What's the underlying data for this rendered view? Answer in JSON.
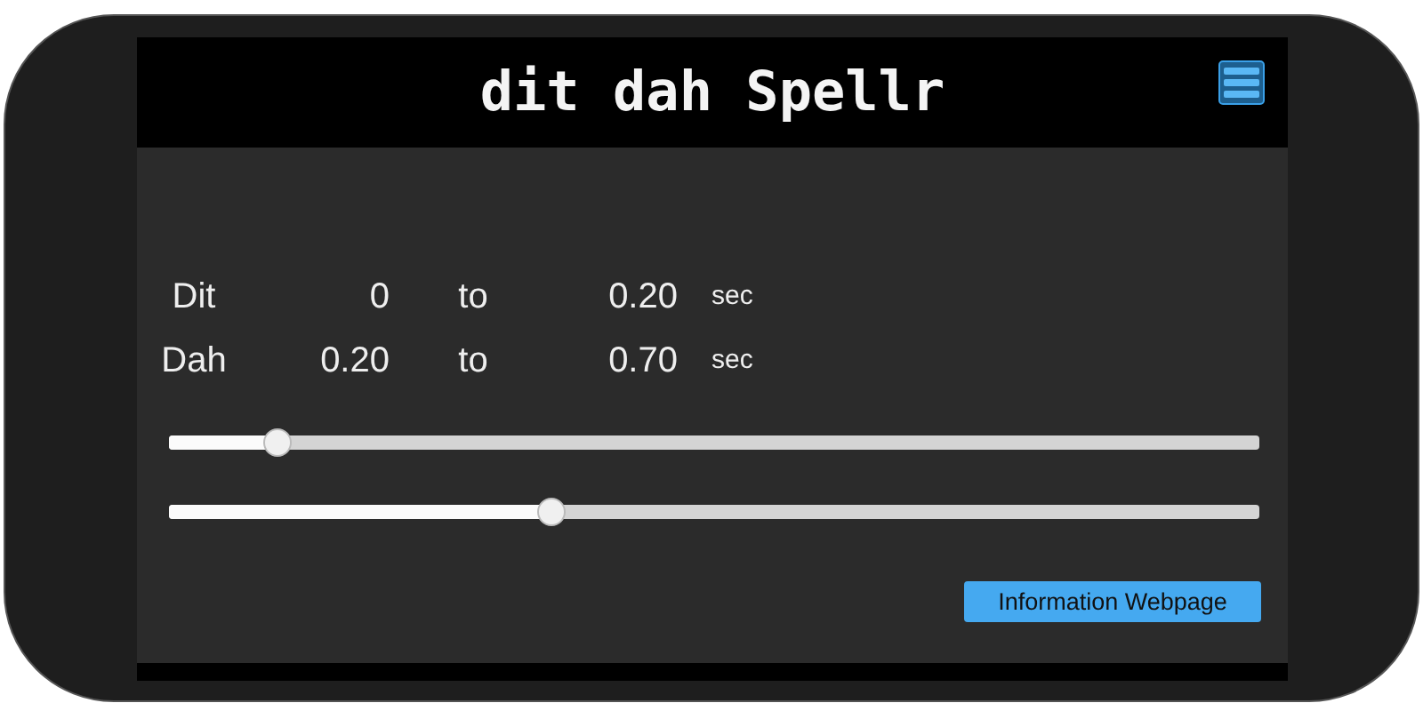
{
  "header": {
    "title": "dit dah Spellr"
  },
  "ranges": [
    {
      "label": "Dit",
      "from": "0",
      "joiner": "to",
      "to": "0.20",
      "unit": "sec"
    },
    {
      "label": "Dah",
      "from": "0.20",
      "joiner": "to",
      "to": "0.70",
      "unit": "sec"
    }
  ],
  "sliders": [
    {
      "level": 0.1
    },
    {
      "level": 0.35
    }
  ],
  "button": "Information Webpage"
}
